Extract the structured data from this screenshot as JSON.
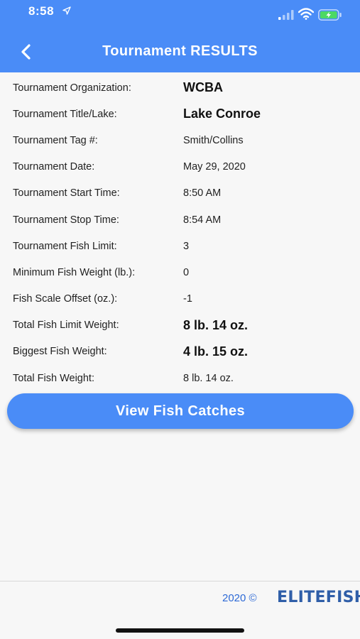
{
  "status": {
    "time": "8:58"
  },
  "header": {
    "title": "Tournament RESULTS"
  },
  "results": [
    {
      "label": "Tournament Organization:",
      "value": "WCBA",
      "emphasis": true
    },
    {
      "label": "Tournament Title/Lake:",
      "value": "Lake Conroe",
      "emphasis": true
    },
    {
      "label": "Tournament Tag #:",
      "value": "Smith/Collins",
      "emphasis": false
    },
    {
      "label": "Tournament Date:",
      "value": "May 29, 2020",
      "emphasis": false
    },
    {
      "label": "Tournament Start Time:",
      "value": "8:50 AM",
      "emphasis": false
    },
    {
      "label": "Tournament Stop Time:",
      "value": "8:54 AM",
      "emphasis": false
    },
    {
      "label": "Tournament Fish Limit:",
      "value": "3",
      "emphasis": false
    },
    {
      "label": "Minimum Fish Weight (lb.):",
      "value": "0",
      "emphasis": false
    },
    {
      "label": "Fish Scale Offset (oz.):",
      "value": "-1",
      "emphasis": false
    },
    {
      "label": "Total Fish Limit Weight:",
      "value": "8 lb. 14 oz.",
      "emphasis": true
    },
    {
      "label": "Biggest Fish Weight:",
      "value": "4 lb. 15 oz.",
      "emphasis": true
    },
    {
      "label": "Total Fish Weight:",
      "value": "8 lb. 14 oz.",
      "emphasis": false
    }
  ],
  "actions": {
    "view_catches_label": "View Fish Catches"
  },
  "footer": {
    "copyright": "2020 ©",
    "brand": "ELITEFISH"
  },
  "colors": {
    "accent": "#4a8cf7",
    "brand": "#2f5ea8",
    "battery": "#4cd964"
  },
  "icons": [
    "location-arrow-icon",
    "signal-icon",
    "wifi-icon",
    "battery-charging-icon",
    "chevron-left-icon"
  ]
}
